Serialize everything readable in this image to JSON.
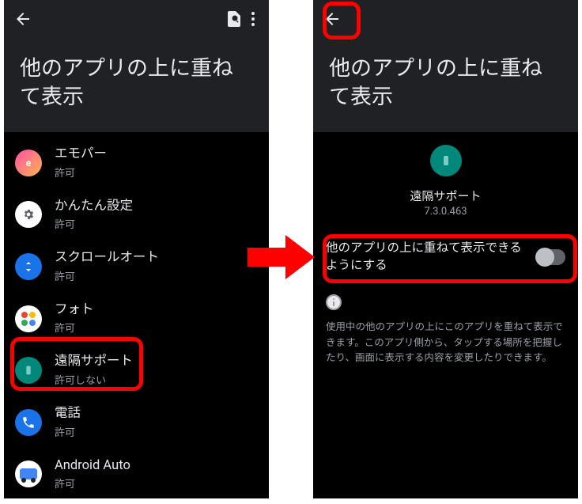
{
  "left": {
    "title": "他のアプリの上に重ねて表示",
    "items": [
      {
        "name": "エモパー",
        "sub": "許可"
      },
      {
        "name": "かんたん設定",
        "sub": "許可"
      },
      {
        "name": "スクロールオート",
        "sub": "許可"
      },
      {
        "name": "フォト",
        "sub": "許可"
      },
      {
        "name": "遠隔サポート",
        "sub": "許可しない"
      },
      {
        "name": "電話",
        "sub": "許可"
      },
      {
        "name": "Android Auto",
        "sub": "許可"
      }
    ]
  },
  "right": {
    "title": "他のアプリの上に重ねて表示",
    "app_name": "遠隔サポート",
    "app_version": "7.3.0.463",
    "toggle_label": "他のアプリの上に重ねて表示できるようにする",
    "desc": "使用中の他のアプリの上にこのアプリを重ねて表示できます。このアプリ側から、タップする場所を把握したり、画面に表示する内容を変更したりできます。"
  }
}
